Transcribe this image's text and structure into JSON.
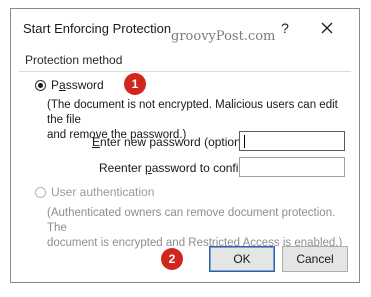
{
  "dialog": {
    "title": "Start Enforcing Protection",
    "watermark": "groovyPost.com",
    "help_glyph": "?",
    "close_icon": "close-icon"
  },
  "protection": {
    "group_label": "Protection method",
    "password_option": {
      "label_pre": "P",
      "label_accel": "a",
      "label_post": "ssword",
      "selected": true,
      "description_line1": "(The document is not encrypted. Malicious users can edit the file",
      "description_line2": "and remove the password.)",
      "new_password_label_pre": "",
      "new_password_label_accel": "E",
      "new_password_label_post": "nter new password (optional):",
      "new_password_value": "",
      "confirm_label_pre": "Reenter ",
      "confirm_label_accel": "p",
      "confirm_label_post": "assword to confirm:",
      "confirm_value": ""
    },
    "user_auth_option": {
      "label": "User authentication",
      "selected": false,
      "disabled": true,
      "description_line1": "(Authenticated owners can remove document protection. The",
      "description_line2": "document is encrypted and Restricted Access is enabled.)"
    }
  },
  "callouts": {
    "one": "1",
    "two": "2",
    "color": "#d1261d"
  },
  "buttons": {
    "ok_label": "OK",
    "cancel_label": "Cancel"
  }
}
